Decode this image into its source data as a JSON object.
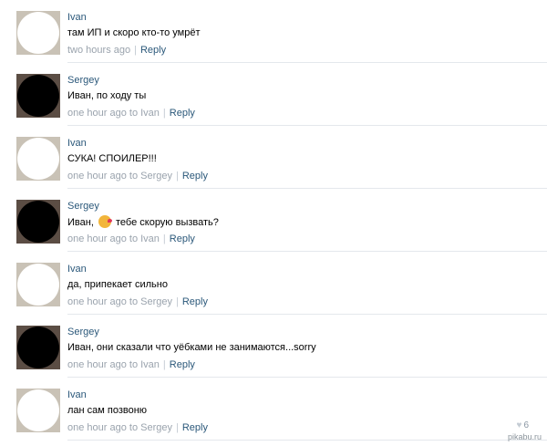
{
  "comments": [
    {
      "author": "Ivan",
      "avatar": "white",
      "text": "там ИП и скоро кто-то умрёт",
      "time": "two hours ago",
      "reply_label": "Reply"
    },
    {
      "author": "Sergey",
      "avatar": "dark",
      "text": "Иван, по ходу ты",
      "time": "one hour ago to Ivan",
      "reply_label": "Reply"
    },
    {
      "author": "Ivan",
      "avatar": "white",
      "text": "СУКА! СПОИЛЕР!!!",
      "time": "one hour ago to Sergey",
      "reply_label": "Reply"
    },
    {
      "author": "Sergey",
      "avatar": "dark",
      "text_before": "Иван,",
      "emoji": "kissing-face-emoji",
      "text_after": "тебе скорую вызвать?",
      "time": "one hour ago to Ivan",
      "reply_label": "Reply"
    },
    {
      "author": "Ivan",
      "avatar": "white",
      "text": "да, припекает сильно",
      "time": "one hour ago to Sergey",
      "reply_label": "Reply"
    },
    {
      "author": "Sergey",
      "avatar": "dark",
      "text": "Иван, они сказали что уёбками не занимаются...sorry",
      "time": "one hour ago to Ivan",
      "reply_label": "Reply"
    },
    {
      "author": "Ivan",
      "avatar": "white",
      "text": "лан сам позвоню",
      "time": "one hour ago to Sergey",
      "reply_label": "Reply"
    }
  ],
  "likes": {
    "icon": "heart-icon",
    "count": "6"
  },
  "watermark": "pikabu.ru",
  "colors": {
    "link": "#2b587a",
    "meta": "#9aa3ad",
    "divider": "#e4e8ec"
  }
}
